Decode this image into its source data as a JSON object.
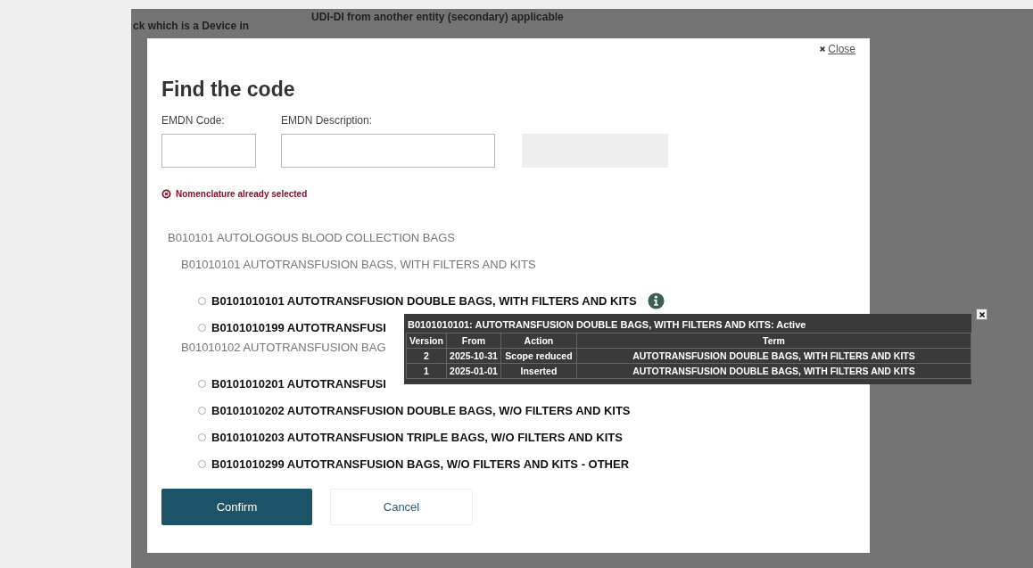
{
  "background": {
    "texts": [
      "ck which is a Device in",
      "UDI-DI from another entity (secondary) applicable"
    ]
  },
  "modal": {
    "close_label": "Close",
    "title": "Find the code",
    "fields": [
      {
        "label": "EMDN Code:",
        "kind": "narrow"
      },
      {
        "label": "EMDN Description:",
        "kind": "wide"
      }
    ],
    "search_button": {
      "disabled": true
    },
    "error": "Nomenclature already selected",
    "tree": [
      {
        "label": "B010101 AUTOLOGOUS BLOOD COLLECTION BAGS",
        "children": [
          {
            "label": "B01010101 AUTOTRANSFUSION BAGS, WITH FILTERS AND KITS",
            "children": [
              {
                "label": "B0101010101 AUTOTRANSFUSION DOUBLE BAGS, WITH FILTERS AND KITS",
                "selected": false,
                "info": true
              },
              {
                "label": "B0101010199 AUTOTRANSFUSI",
                "selected": false,
                "info": false
              }
            ]
          },
          {
            "label": "B01010102 AUTOTRANSFUSION BAG",
            "children": [
              {
                "label": "B0101010201 AUTOTRANSFUSI",
                "selected": false,
                "info": false
              },
              {
                "label": "B0101010202 AUTOTRANSFUSION DOUBLE BAGS, W/O FILTERS AND KITS",
                "selected": false,
                "info": false
              },
              {
                "label": "B0101010203 AUTOTRANSFUSION TRIPLE BAGS, W/O FILTERS AND KITS",
                "selected": false,
                "info": false
              },
              {
                "label": "B0101010299 AUTOTRANSFUSION BAGS, W/O FILTERS AND KITS - OTHER",
                "selected": false,
                "info": false
              }
            ]
          }
        ]
      }
    ],
    "buttons": [
      {
        "label": "Confirm",
        "kind": "primary"
      },
      {
        "label": "Cancel",
        "kind": "secondary"
      }
    ]
  },
  "tooltip": {
    "title": "B0101010101: AUTOTRANSFUSION DOUBLE BAGS, WITH FILTERS AND KITS: Active",
    "columns": [
      "Version",
      "From",
      "Action",
      "Term"
    ],
    "rows": [
      [
        "2",
        "2025-10-31",
        "Scope reduced",
        "AUTOTRANSFUSION DOUBLE BAGS, WITH FILTERS AND KITS"
      ],
      [
        "1",
        "2025-01-01",
        "Inserted",
        "AUTOTRANSFUSION DOUBLE BAGS, WITH FILTERS AND KITS"
      ]
    ]
  }
}
